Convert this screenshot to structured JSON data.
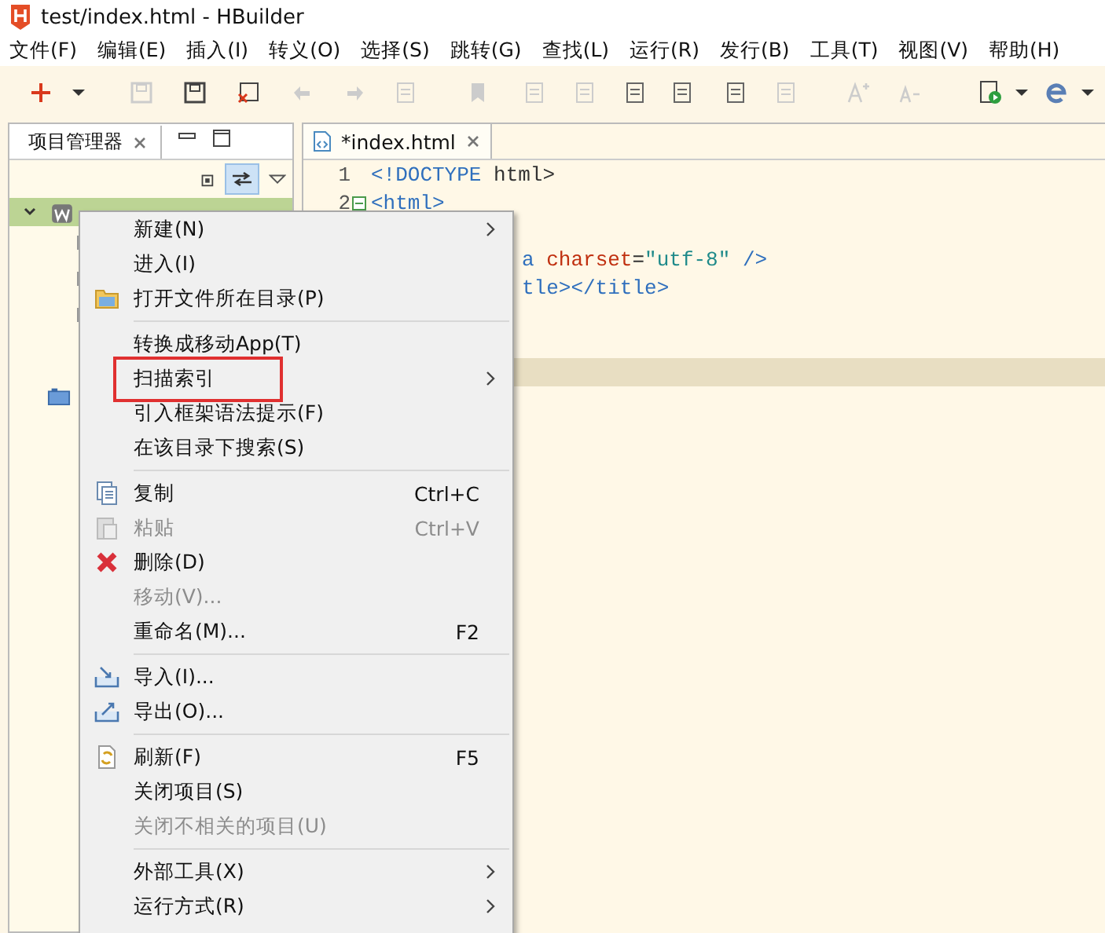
{
  "window": {
    "title": "test/index.html  -  HBuilder"
  },
  "menu_bar": [
    "文件(F)",
    "编辑(E)",
    "插入(I)",
    "转义(O)",
    "选择(S)",
    "跳转(G)",
    "查找(L)",
    "运行(R)",
    "发行(B)",
    "工具(T)",
    "视图(V)",
    "帮助(H)"
  ],
  "project_panel": {
    "tab": {
      "label": "项目管理器",
      "selected": true
    },
    "tree": [
      {
        "expanded": true,
        "selected": true
      }
    ]
  },
  "editor": {
    "tab": {
      "label": "*index.html",
      "selected": true
    },
    "lines": [
      {
        "number": "1",
        "current": false,
        "tokens": [
          {
            "text": "<!DOCTYPE",
            "kind": "tag"
          },
          {
            "text": " html>",
            "kind": "plain"
          }
        ]
      },
      {
        "number": "2",
        "current": false,
        "foldable": true,
        "tokens": [
          {
            "text": "<html>",
            "kind": "tag"
          }
        ]
      },
      {
        "current": false
      },
      {
        "clipped": true,
        "current": false,
        "tokens": [
          {
            "text": "a",
            "kind": "tag"
          },
          {
            "text": " charset",
            "kind": "attr"
          },
          {
            "text": "=",
            "kind": "plain"
          },
          {
            "text": "\"utf-8\"",
            "kind": "string"
          },
          {
            "text": " />",
            "kind": "tag"
          }
        ]
      },
      {
        "clipped": true,
        "current": false,
        "tokens": [
          {
            "text": "tle></title>",
            "kind": "tag"
          }
        ]
      },
      {
        "current": false
      },
      {
        "current": false
      },
      {
        "current": true
      }
    ]
  },
  "context_menu": [
    {
      "kind": "item",
      "label": "新建(N)",
      "submenu": true,
      "disabled": false
    },
    {
      "kind": "item",
      "label": "进入(I)",
      "disabled": false
    },
    {
      "kind": "item",
      "label": "打开文件所在目录(P)",
      "disabled": false
    },
    {
      "kind": "separator"
    },
    {
      "kind": "item",
      "label": "转换成移动App(T)",
      "disabled": false
    },
    {
      "kind": "item",
      "label": "扫描索引",
      "submenu": true,
      "disabled": false,
      "highlighted": true
    },
    {
      "kind": "item",
      "label": "引入框架语法提示(F)",
      "disabled": false
    },
    {
      "kind": "item",
      "label": "在该目录下搜索(S)",
      "disabled": false
    },
    {
      "kind": "separator"
    },
    {
      "kind": "item",
      "label": "复制",
      "shortcut": "Ctrl+C",
      "disabled": false
    },
    {
      "kind": "item",
      "label": "粘贴",
      "shortcut": "Ctrl+V",
      "disabled": true
    },
    {
      "kind": "item",
      "label": "删除(D)",
      "disabled": false
    },
    {
      "kind": "item",
      "label": "移动(V)...",
      "disabled": true
    },
    {
      "kind": "item",
      "label": "重命名(M)...",
      "shortcut": "F2",
      "disabled": false
    },
    {
      "kind": "separator"
    },
    {
      "kind": "item",
      "label": "导入(I)...",
      "disabled": false
    },
    {
      "kind": "item",
      "label": "导出(O)...",
      "disabled": false
    },
    {
      "kind": "separator"
    },
    {
      "kind": "item",
      "label": "刷新(F)",
      "shortcut": "F5",
      "disabled": false
    },
    {
      "kind": "item",
      "label": "关闭项目(S)",
      "disabled": false
    },
    {
      "kind": "item",
      "label": "关闭不相关的项目(U)",
      "disabled": true
    },
    {
      "kind": "separator"
    },
    {
      "kind": "item",
      "label": "外部工具(X)",
      "submenu": true,
      "disabled": false
    },
    {
      "kind": "item",
      "label": "运行方式(R)",
      "submenu": true,
      "disabled": false
    }
  ]
}
